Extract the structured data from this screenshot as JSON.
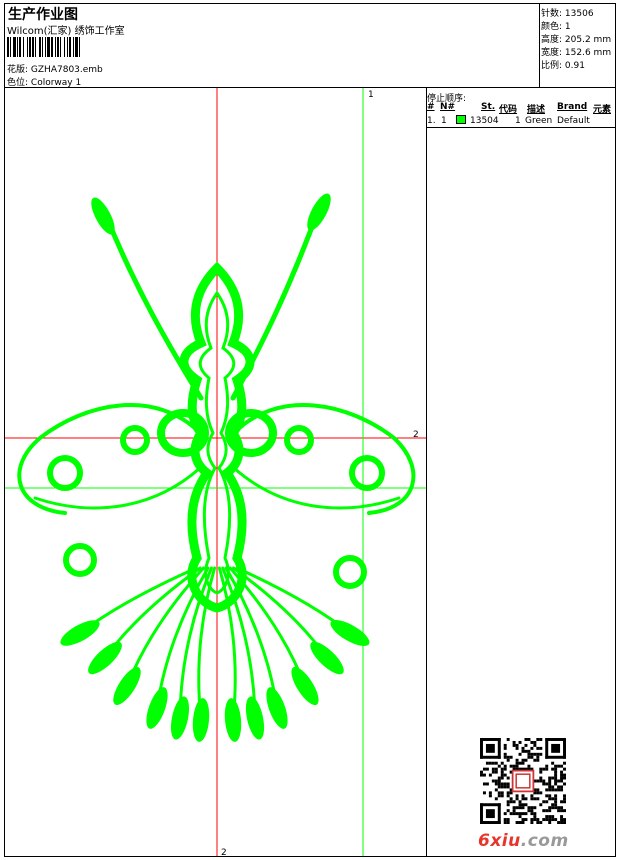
{
  "header": {
    "title": "生产作业图",
    "subtitle": "Wilcom(汇家) 绣饰工作室",
    "design_label": "花版:",
    "design_value": "GZHA7803.emb",
    "colorway_label": "色位:",
    "colorway_value": "Colorway 1"
  },
  "stats": {
    "stitches_label": "针数:",
    "stitches_value": "13506",
    "colors_label": "颜色:",
    "colors_value": "1",
    "height_label": "高度:",
    "height_value": "205.2 mm",
    "width_label": "宽度:",
    "width_value": "152.6 mm",
    "scale_label": "比例:",
    "scale_value": "0.91"
  },
  "sequence": {
    "heading": "停止顺序:",
    "columns": [
      "#",
      "N#",
      "St.",
      "代码",
      "描述",
      "Brand",
      "元素"
    ],
    "rows": [
      {
        "num": "1.",
        "n": "1",
        "stitches": "13504",
        "code": "1",
        "desc": "Green",
        "brand": "Default",
        "color": "#00ff00"
      }
    ]
  },
  "canvas": {
    "marker_top_green": "1",
    "marker_right_red": "2",
    "marker_bottom_red": "2",
    "guide_red": "#ff0000",
    "guide_green": "#00ff00",
    "thread_color": "#00ff00"
  },
  "watermark": {
    "brand_main": "6xiu",
    "brand_suffix": ".com"
  }
}
